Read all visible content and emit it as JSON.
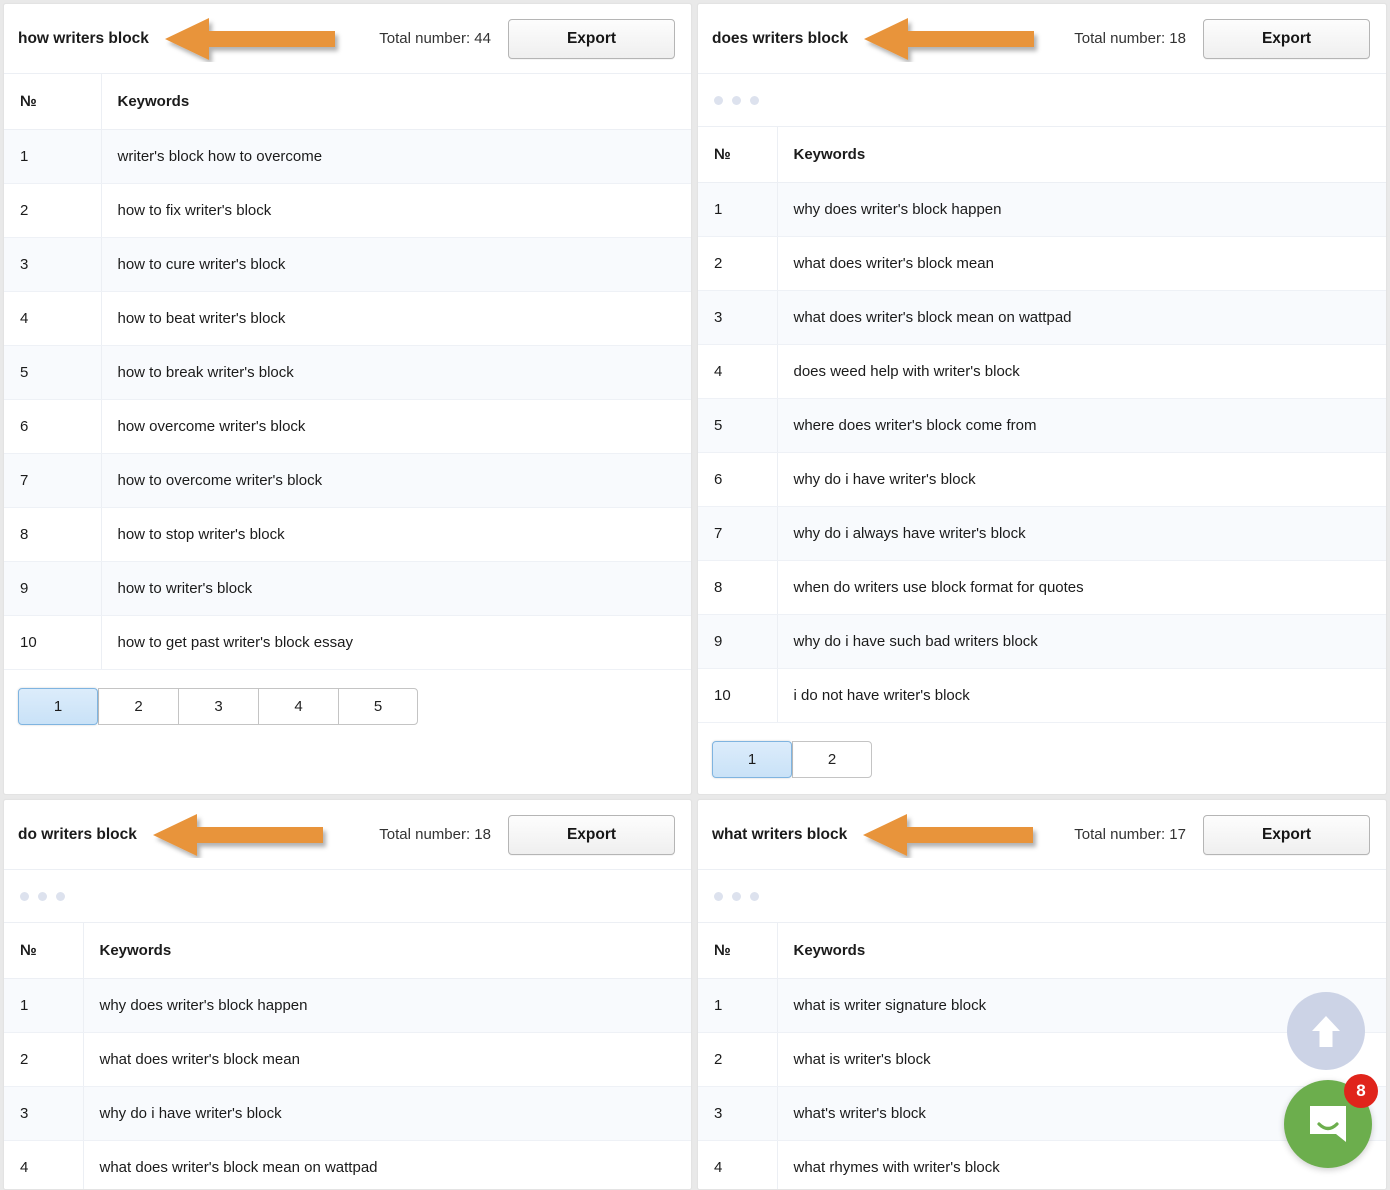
{
  "common": {
    "export_label": "Export",
    "col_num_label": "№",
    "col_keywords_label": "Keywords",
    "total_prefix": "Total number:",
    "arrow_color": "#e8943a",
    "active_page_accent": "#7fb4e0",
    "dot_color": "#dde2ee",
    "row_stripe_color": "#f8fafd"
  },
  "panels": [
    {
      "title": "how writers block",
      "total_label": "Total number: 44",
      "has_dots_row": false,
      "rows": [
        {
          "n": "1",
          "keyword": "writer's block how to overcome"
        },
        {
          "n": "2",
          "keyword": "how to fix writer's block"
        },
        {
          "n": "3",
          "keyword": "how to cure writer's block"
        },
        {
          "n": "4",
          "keyword": "how to beat writer's block"
        },
        {
          "n": "5",
          "keyword": "how to break writer's block"
        },
        {
          "n": "6",
          "keyword": "how overcome writer's block"
        },
        {
          "n": "7",
          "keyword": "how to overcome writer's block"
        },
        {
          "n": "8",
          "keyword": "how to stop writer's block"
        },
        {
          "n": "9",
          "keyword": "how to writer's block"
        },
        {
          "n": "10",
          "keyword": "how to get past writer's block essay"
        }
      ],
      "pages": [
        "1",
        "2",
        "3",
        "4",
        "5"
      ],
      "active_page": "1"
    },
    {
      "title": "does writers block",
      "total_label": "Total number: 18",
      "has_dots_row": true,
      "rows": [
        {
          "n": "1",
          "keyword": "why does writer's block happen"
        },
        {
          "n": "2",
          "keyword": "what does writer's block mean"
        },
        {
          "n": "3",
          "keyword": "what does writer's block mean on wattpad"
        },
        {
          "n": "4",
          "keyword": "does weed help with writer's block"
        },
        {
          "n": "5",
          "keyword": "where does writer's block come from"
        },
        {
          "n": "6",
          "keyword": "why do i have writer's block"
        },
        {
          "n": "7",
          "keyword": "why do i always have writer's block"
        },
        {
          "n": "8",
          "keyword": "when do writers use block format for quotes"
        },
        {
          "n": "9",
          "keyword": "why do i have such bad writers block"
        },
        {
          "n": "10",
          "keyword": "i do not have writer's block"
        }
      ],
      "pages": [
        "1",
        "2"
      ],
      "active_page": "1"
    },
    {
      "title": "do writers block",
      "total_label": "Total number: 18",
      "has_dots_row": true,
      "rows": [
        {
          "n": "1",
          "keyword": "why does writer's block happen"
        },
        {
          "n": "2",
          "keyword": "what does writer's block mean"
        },
        {
          "n": "3",
          "keyword": "why do i have writer's block"
        },
        {
          "n": "4",
          "keyword": "what does writer's block mean on wattpad"
        }
      ],
      "pages": [],
      "active_page": ""
    },
    {
      "title": "what writers block",
      "total_label": "Total number: 17",
      "has_dots_row": true,
      "rows": [
        {
          "n": "1",
          "keyword": "what is writer signature block"
        },
        {
          "n": "2",
          "keyword": "what is writer's block"
        },
        {
          "n": "3",
          "keyword": "what's writer's block"
        },
        {
          "n": "4",
          "keyword": "what rhymes with writer's block"
        }
      ],
      "pages": [],
      "active_page": ""
    }
  ],
  "widgets": {
    "scroll_top_icon": "arrow-up-icon",
    "messenger_icon": "chat-bubble-icon",
    "messenger_unread_count": "8"
  }
}
